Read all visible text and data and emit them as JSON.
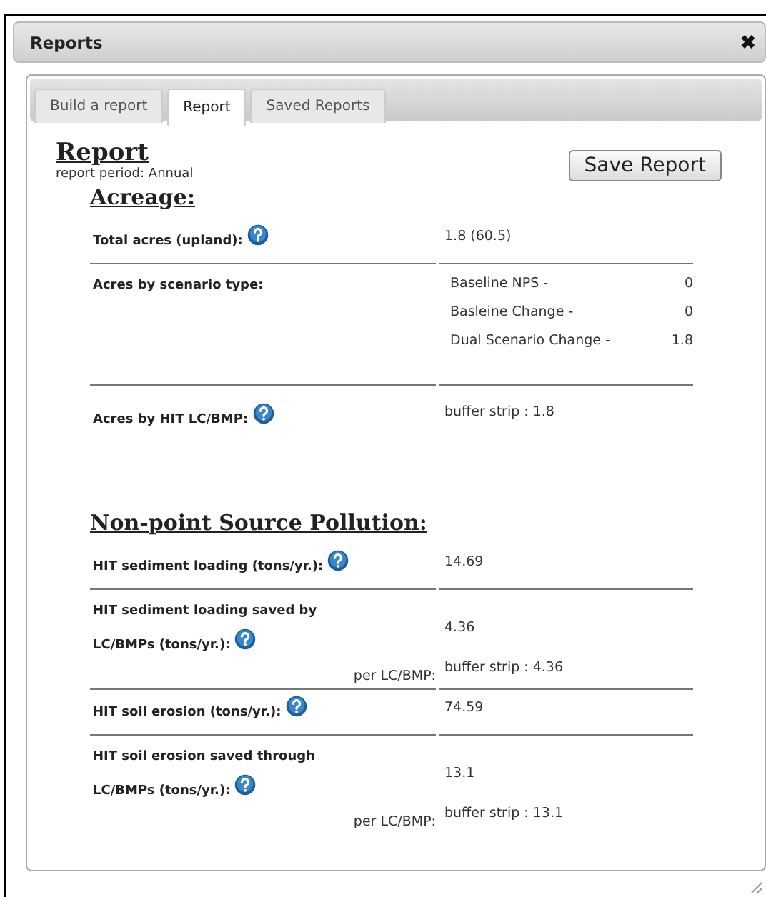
{
  "window": {
    "title": "Reports",
    "close": "✖"
  },
  "tabs": [
    {
      "label": "Build a report",
      "selected": false
    },
    {
      "label": "Report",
      "selected": true
    },
    {
      "label": "Saved Reports",
      "selected": false
    }
  ],
  "report": {
    "title": "Report",
    "period": "report period: Annual",
    "save_button": "Save Report"
  },
  "sections": [
    {
      "heading": "Acreage:",
      "rows": [
        {
          "kind": "simple",
          "label": "Total acres (upland):",
          "help": true,
          "value": "1.8 (60.5)"
        },
        {
          "kind": "list",
          "label": "Acres by scenario type:",
          "help": false,
          "items": [
            {
              "name": "Baseline NPS -",
              "value": "0"
            },
            {
              "name": "Basleine Change -",
              "value": "0"
            },
            {
              "name": "Dual Scenario Change -",
              "value": "1.8"
            }
          ]
        },
        {
          "kind": "simple",
          "label": "Acres by HIT LC/BMP:",
          "help": true,
          "value": "buffer strip : 1.8"
        }
      ]
    },
    {
      "heading": "Non-point Source Pollution:",
      "rows": [
        {
          "kind": "simple",
          "label": "HIT sediment loading (tons/yr.):",
          "help": true,
          "value": "14.69"
        },
        {
          "kind": "breakdown",
          "label": "HIT sediment loading saved by LC/BMPs (tons/yr.):",
          "help": true,
          "value": "4.36",
          "per_label": "per LC/BMP:",
          "per_value": "buffer strip : 4.36"
        },
        {
          "kind": "simple",
          "label": "HIT soil erosion (tons/yr.):",
          "help": true,
          "value": "74.59"
        },
        {
          "kind": "breakdown",
          "label": "HIT soil erosion saved through LC/BMPs (tons/yr.):",
          "help": true,
          "value": "13.1",
          "per_label": "per LC/BMP:",
          "per_value": "buffer strip : 13.1"
        }
      ]
    }
  ]
}
